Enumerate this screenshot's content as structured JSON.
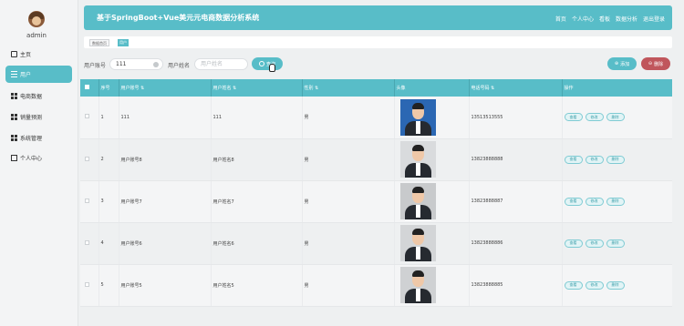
{
  "sidebar": {
    "username": "admin",
    "items": [
      {
        "label": "主页",
        "icon": "home-icon"
      },
      {
        "label": "用户",
        "icon": "list-icon"
      },
      {
        "label": "电商数据",
        "icon": "grid-icon"
      },
      {
        "label": "销量预测",
        "icon": "grid-icon"
      },
      {
        "label": "系统管理",
        "icon": "grid-icon"
      },
      {
        "label": "个人中心",
        "icon": "mail-icon"
      }
    ]
  },
  "header": {
    "title": "基于SpringBoot+Vue美元元电商数据分析系统",
    "nav": [
      "首页",
      "个人中心",
      "看板",
      "数据分析",
      "退出登录"
    ]
  },
  "tabs": [
    "数据首页",
    "用户"
  ],
  "search": {
    "account_label": "用户账号",
    "account_value": "111",
    "name_label": "用户姓名",
    "name_placeholder": "用户姓名",
    "search_button": "查询",
    "add_button": "添加",
    "delete_button": "删除"
  },
  "table": {
    "headers": [
      "序号",
      "用户账号",
      "用户姓名",
      "性别",
      "头像",
      "电话号码",
      "操作"
    ],
    "rows": [
      {
        "index": "1",
        "account": "111",
        "name": "111",
        "gender": "男",
        "phone": "13513513555",
        "photo_bg": "#2b67b3"
      },
      {
        "index": "2",
        "account": "用户账号8",
        "name": "用户姓名8",
        "gender": "男",
        "phone": "13823888888",
        "photo_bg": "#d9dbdd"
      },
      {
        "index": "3",
        "account": "用户账号7",
        "name": "用户姓名7",
        "gender": "男",
        "phone": "13823888887",
        "photo_bg": "#c8cacc"
      },
      {
        "index": "4",
        "account": "用户账号6",
        "name": "用户姓名6",
        "gender": "男",
        "phone": "13823888886",
        "photo_bg": "#d3d5d7"
      },
      {
        "index": "5",
        "account": "用户账号5",
        "name": "用户姓名5",
        "gender": "男",
        "phone": "13823888885",
        "photo_bg": "#cfd1d3"
      }
    ],
    "row_actions": [
      "查看",
      "修改",
      "删除"
    ]
  },
  "colors": {
    "accent": "#58bdc8",
    "danger": "#c0565c"
  }
}
